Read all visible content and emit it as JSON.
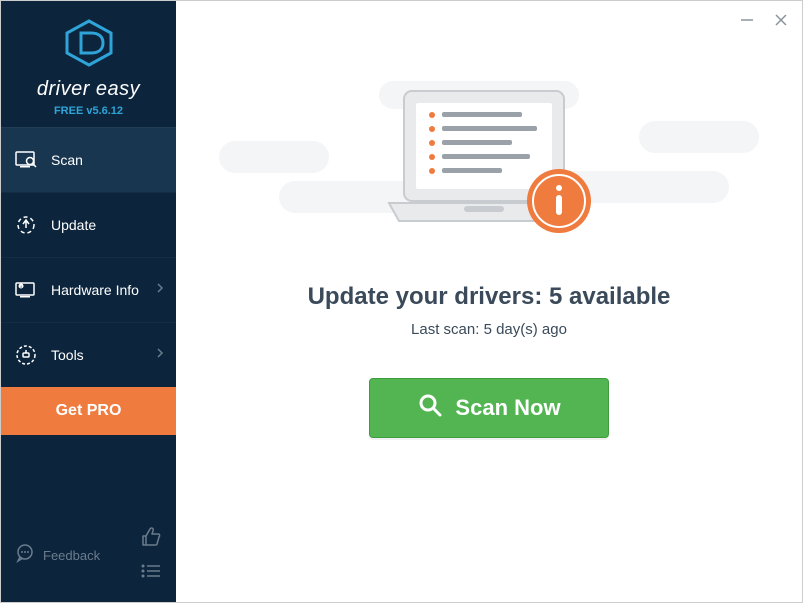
{
  "app": {
    "name": "driver easy",
    "version_label": "FREE v5.6.12"
  },
  "sidebar": {
    "items": [
      {
        "label": "Scan",
        "icon": "scan",
        "active": true,
        "submenu": false
      },
      {
        "label": "Update",
        "icon": "update",
        "active": false,
        "submenu": false
      },
      {
        "label": "Hardware Info",
        "icon": "hardware",
        "active": false,
        "submenu": true
      },
      {
        "label": "Tools",
        "icon": "tools",
        "active": false,
        "submenu": true
      }
    ],
    "get_pro_label": "Get PRO",
    "feedback_label": "Feedback"
  },
  "main": {
    "headline": "Update your drivers: 5 available",
    "lastscan": "Last scan: 5 day(s) ago",
    "scan_button": "Scan Now"
  },
  "colors": {
    "sidebar_bg": "#0c253c",
    "accent_orange": "#ef7b3e",
    "accent_green": "#53b552",
    "brand_blue": "#2fa4d8"
  }
}
